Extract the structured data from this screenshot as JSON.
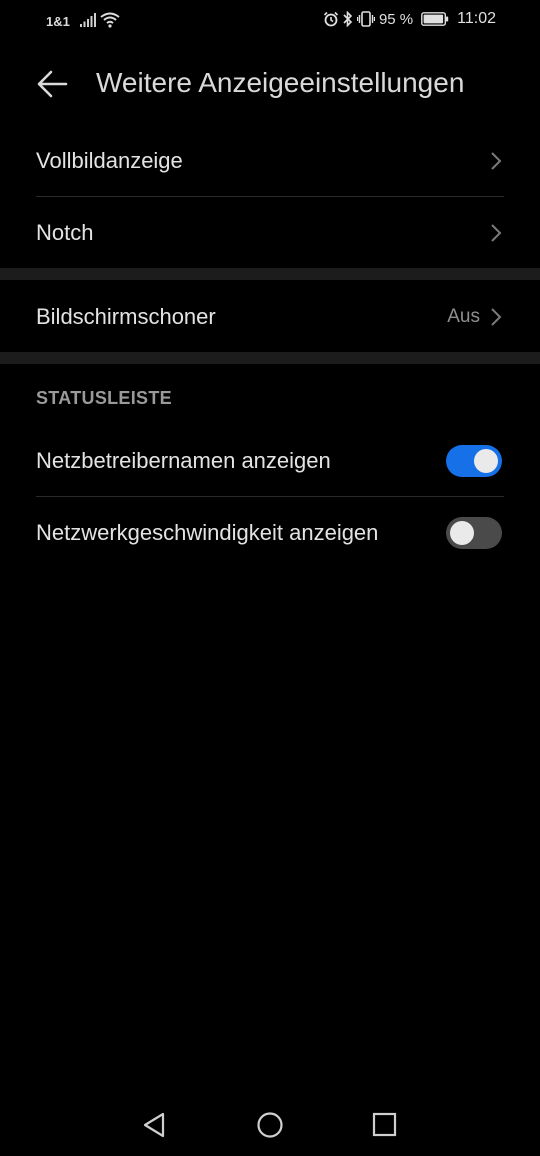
{
  "status_bar": {
    "carrier": "1&1",
    "battery_text": "95 %",
    "time": "11:02",
    "icons": [
      "signal-icon",
      "wifi-icon",
      "alarm-icon",
      "bluetooth-icon",
      "vibrate-icon",
      "battery-icon"
    ]
  },
  "header": {
    "title": "Weitere Anzeigeeinstellungen",
    "back_icon": "arrow-left-icon"
  },
  "rows": {
    "fullscreen": {
      "label": "Vollbildanzeige"
    },
    "notch": {
      "label": "Notch"
    },
    "screensaver": {
      "label": "Bildschirmschoner",
      "value": "Aus"
    }
  },
  "statusbar_section": {
    "header": "STATUSLEISTE",
    "carrier_name": {
      "label": "Netzbetreibernamen anzeigen",
      "enabled": true
    },
    "network_speed": {
      "label": "Netzwerkgeschwindigkeit anzeigen",
      "enabled": false
    }
  },
  "colors": {
    "background": "#000000",
    "accent": "#1670e8",
    "toggle_off": "#4a4a4a"
  },
  "navigation": {
    "icons": [
      "back-triangle-icon",
      "home-circle-icon",
      "recents-square-icon"
    ]
  }
}
